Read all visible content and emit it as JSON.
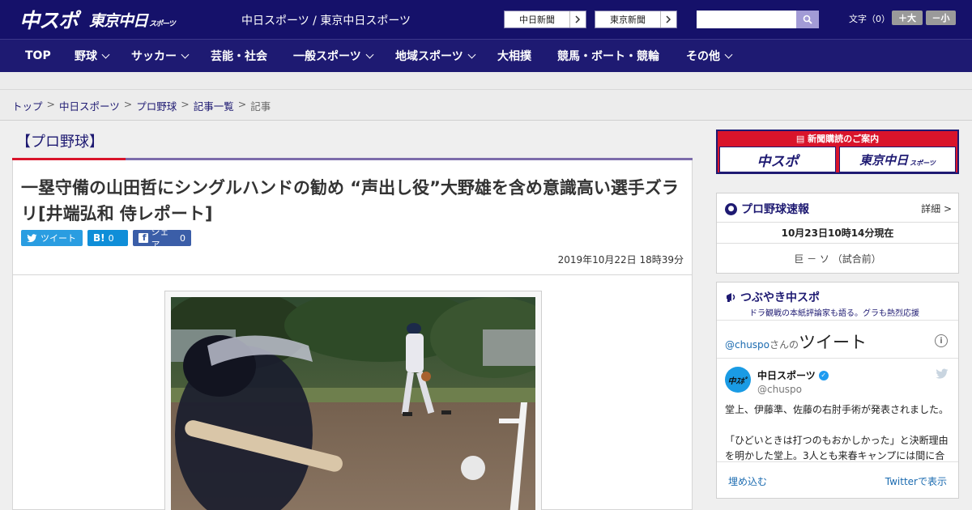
{
  "header": {
    "logo_chuspo": "中スポ",
    "logo_tokyo": "東京中日",
    "logo_tokyo_small": "スポーツ",
    "site_names": "中日スポーツ / 東京中日スポーツ",
    "link_chunichi": "中日新聞",
    "link_tokyo": "東京新聞",
    "font_size_label": "文字（0）",
    "font_plus": "＋大",
    "font_minus": "－小"
  },
  "nav": {
    "items": [
      {
        "label": "TOP",
        "has_dropdown": false
      },
      {
        "label": "野球",
        "has_dropdown": true
      },
      {
        "label": "サッカー",
        "has_dropdown": true
      },
      {
        "label": "芸能・社会",
        "has_dropdown": false
      },
      {
        "label": "一般スポーツ",
        "has_dropdown": true
      },
      {
        "label": "地域スポーツ",
        "has_dropdown": true
      },
      {
        "label": "大相撲",
        "has_dropdown": false
      },
      {
        "label": "競馬・ボート・競輪",
        "has_dropdown": false
      },
      {
        "label": "その他",
        "has_dropdown": true
      }
    ]
  },
  "breadcrumb": {
    "items": [
      "トップ",
      "中日スポーツ",
      "プロ野球",
      "記事一覧"
    ],
    "separator": ">",
    "current": "記事"
  },
  "article": {
    "category": "【プロ野球】",
    "headline": "一塁守備の山田哲にシングルハンドの勧め “声出し役”大野雄を含め意識高い選手ズラリ[井端弘和 侍レポート]",
    "share_tweet": "ツイート",
    "share_hatena_count": "0",
    "share_facebook": "シェア",
    "share_facebook_count": "0",
    "published": "2019年10月22日 18時39分"
  },
  "sidebar": {
    "subscribe_title": "新聞購読のご案内",
    "subscribe_chuspo": "中スポ",
    "subscribe_tokyo": "東京中日",
    "subscribe_tokyo_small": "スポーツ",
    "score_title": "プロ野球速報",
    "score_detail": "詳細 >",
    "score_time": "10月23日10時14分現在",
    "score_game": "巨 － ソ （試合前）",
    "tweet_title": "つぶやき中スポ",
    "tweet_sub": "ドラ観戦の本紙評論家も語る。グラも熱烈応援",
    "tweets_handle": "@chuspo",
    "tweets_san": "さんの",
    "tweets_word": "ツイート",
    "tweet_name": "中日スポーツ",
    "tweet_handle": "@chuspo",
    "tweet_p1": "堂上、伊藤準、佐藤の右肘手術が発表されました。",
    "tweet_p2": "「ひどいときは打つのもおかしかった」と決断理由を明かした堂上。3人とも来春キャンプには間に合",
    "embed": "埋め込む",
    "view_on_twitter": "Twitterで表示"
  },
  "colors": {
    "header_bg": "#15116a",
    "nav_bg": "#1e1a72",
    "accent_red": "#d9142b",
    "accent_purple": "#7d6cab",
    "twitter_blue": "#2a9de1",
    "facebook_blue": "#3b5ea8"
  }
}
